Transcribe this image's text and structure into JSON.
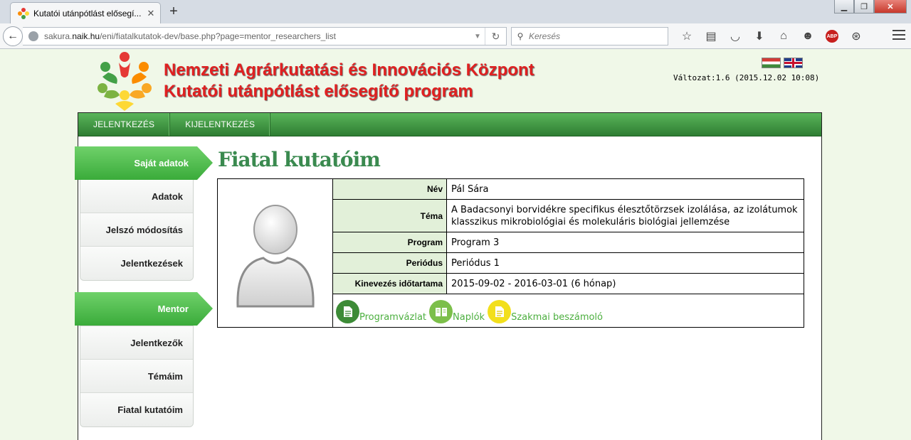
{
  "browser": {
    "tab_title": "Kutatói utánpótlást elősegí...",
    "tab_close": "✕",
    "new_tab": "+",
    "url_prefix": "sakura.",
    "url_domain": "naik.hu",
    "url_path": "/eni/fiatalkutatok-dev/base.php?page=mentor_researchers_list",
    "search_placeholder": "Keresés"
  },
  "header": {
    "title_line1": "Nemzeti Agrárkutatási és Innovációs Központ",
    "title_line2": "Kutatói utánpótlást elősegítő program",
    "version": "Változat:1.6 (2015.12.02 10:08)"
  },
  "menu": [
    {
      "label": "JELENTKEZÉS"
    },
    {
      "label": "KIJELENTKEZÉS"
    }
  ],
  "sidebar": {
    "sections": [
      {
        "title": "Saját adatok",
        "items": [
          "Adatok",
          "Jelszó módosítás",
          "Jelentkezések"
        ]
      },
      {
        "title": "Mentor",
        "items": [
          "Jelentkezők",
          "Témáim",
          "Fiatal kutatóim"
        ]
      }
    ]
  },
  "main": {
    "title": "Fiatal kutatóim",
    "researcher": {
      "fields": [
        {
          "label": "Név",
          "value": "Pál Sára"
        },
        {
          "label": "Téma",
          "value": "A Badacsonyi borvidékre specifikus élesztőtörzsek izolálása, az izolátumok klasszikus mikrobiológiai és molekuláris biológiai jellemzése"
        },
        {
          "label": "Program",
          "value": "Program 3"
        },
        {
          "label": "Periódus",
          "value": "Periódus 1"
        },
        {
          "label": "Kinevezés időtartama",
          "value": "2015-09-02 - 2016-03-01 (6 hónap)"
        }
      ],
      "actions": [
        {
          "label": "Programvázlat",
          "color": "#3d8b37",
          "icon": "document-icon"
        },
        {
          "label": "Naplók",
          "color": "#7cbf4a",
          "icon": "book-icon"
        },
        {
          "label": "Szakmai beszámoló",
          "color": "#f2df1c",
          "icon": "report-icon"
        }
      ]
    }
  }
}
